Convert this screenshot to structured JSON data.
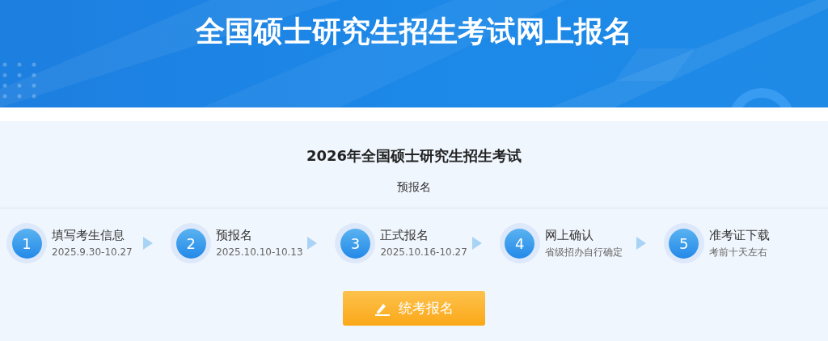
{
  "banner": {
    "title": "全国硕士研究生招生考试网上报名"
  },
  "exam": {
    "title": "2026年全国硕士研究生招生考试",
    "subtitle": "预报名"
  },
  "steps": [
    {
      "number": "1",
      "name": "填写考生信息",
      "date": "2025.9.30-10.27"
    },
    {
      "number": "2",
      "name": "预报名",
      "date": "2025.10.10-10.13"
    },
    {
      "number": "3",
      "name": "正式报名",
      "date": "2025.10.16-10.27"
    },
    {
      "number": "4",
      "name": "网上确认",
      "date": "省级招办自行确定"
    },
    {
      "number": "5",
      "name": "准考证下载",
      "date": "考前十天左右"
    }
  ],
  "button": {
    "label": "统考报名"
  }
}
